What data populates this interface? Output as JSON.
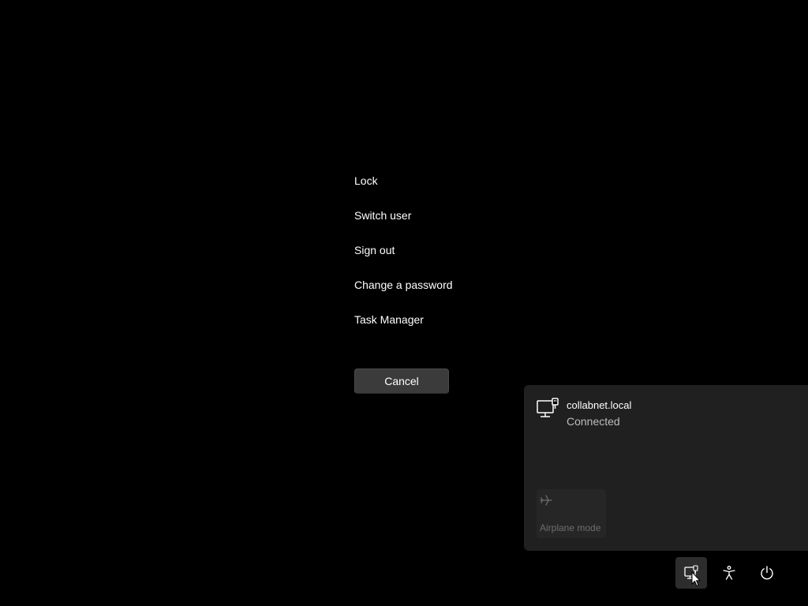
{
  "security_options": {
    "items": [
      {
        "label": "Lock"
      },
      {
        "label": "Switch user"
      },
      {
        "label": "Sign out"
      },
      {
        "label": "Change a password"
      },
      {
        "label": "Task Manager"
      }
    ],
    "cancel_label": "Cancel"
  },
  "network_flyout": {
    "network_name": "collabnet.local",
    "network_status": "Connected",
    "network_icon": "wired-network-icon",
    "airplane_mode": {
      "label": "Airplane mode",
      "icon": "airplane-icon",
      "enabled": false
    }
  },
  "tray": {
    "buttons": [
      {
        "name": "network",
        "icon": "network-icon",
        "active": true
      },
      {
        "name": "accessibility",
        "icon": "accessibility-icon",
        "active": false
      },
      {
        "name": "power",
        "icon": "power-icon",
        "active": false
      }
    ]
  },
  "colors": {
    "background": "#000000",
    "button": "#3b3b3b",
    "flyout": "#202020",
    "text": "#ffffff",
    "muted_text": "#bdbdbd"
  }
}
